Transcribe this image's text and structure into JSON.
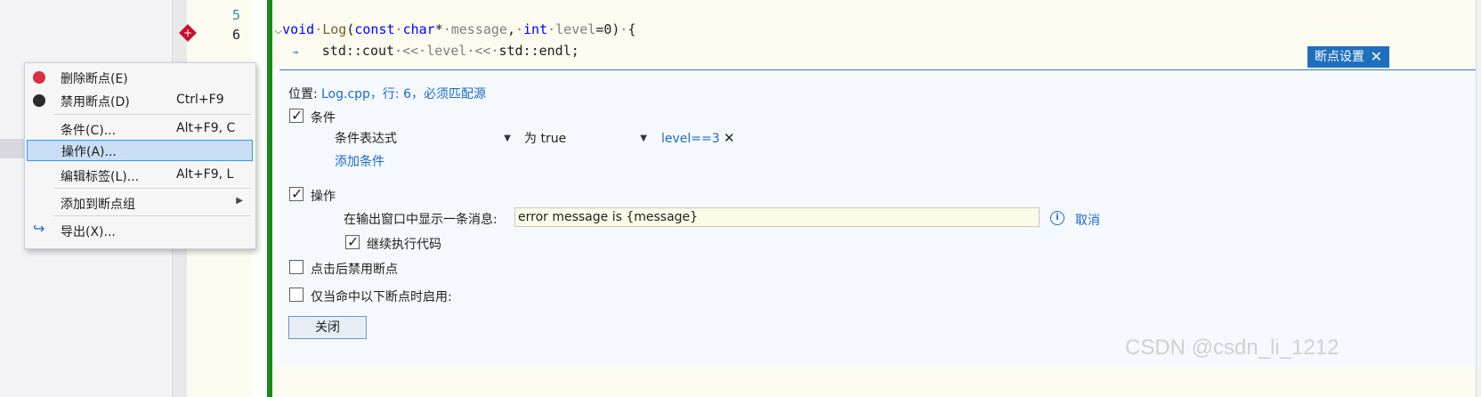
{
  "editor": {
    "line_numbers": [
      "5",
      "6"
    ],
    "line5": {
      "kw_void": "void",
      "fn_log": "Log",
      "punct1": "(",
      "kw_const": "const",
      "kw_char": "char",
      "star": "*",
      "param_message": "message",
      "comma": ",",
      "kw_int": "int",
      "param_level": "level",
      "default": "=0)",
      "brace": "{"
    },
    "line6": {
      "std_cout": "std::cout",
      "op1": "<<",
      "param_level": "level",
      "op2": "<<",
      "std_endl": "std::endl;"
    }
  },
  "breakpoint_settings": {
    "tab_title": "断点设置",
    "close_glyph": "✕",
    "location_label": "位置:",
    "location_value": "Log.cpp，行: 6，必须匹配源",
    "conditions": {
      "label": "条件",
      "checked": true,
      "type_dropdown": "条件表达式",
      "mode_dropdown": "为 true",
      "expression": "level==3",
      "remove_glyph": "✕",
      "add_link": "添加条件"
    },
    "actions": {
      "label": "操作",
      "checked": true,
      "message_label": "在输出窗口中显示一条消息:",
      "message_value": "error message is {message}",
      "cancel_link": "取消",
      "continue_label": "继续执行代码",
      "continue_checked": true
    },
    "disable_once_hit": {
      "label": "点击后禁用断点",
      "checked": false
    },
    "only_enable_when": {
      "label": "仅当命中以下断点时启用:",
      "checked": false
    },
    "close_button": "关闭"
  },
  "context_menu": {
    "items": [
      {
        "label": "删除断点(E)",
        "shortcut": ""
      },
      {
        "label": "禁用断点(D)",
        "shortcut": "Ctrl+F9"
      },
      {
        "label": "条件(C)...",
        "shortcut": "Alt+F9, C"
      },
      {
        "label": "操作(A)...",
        "shortcut": ""
      },
      {
        "label": "编辑标签(L)...",
        "shortcut": "Alt+F9, L"
      },
      {
        "label": "添加到断点组",
        "shortcut": ""
      },
      {
        "label": "导出(X)...",
        "shortcut": ""
      }
    ],
    "selected_index": 3
  },
  "watermark": "CSDN @csdn_li_1212",
  "colors": {
    "accent": "#1f6fbf",
    "breakpoint": "#c8102e",
    "change_bar": "#168a16"
  }
}
